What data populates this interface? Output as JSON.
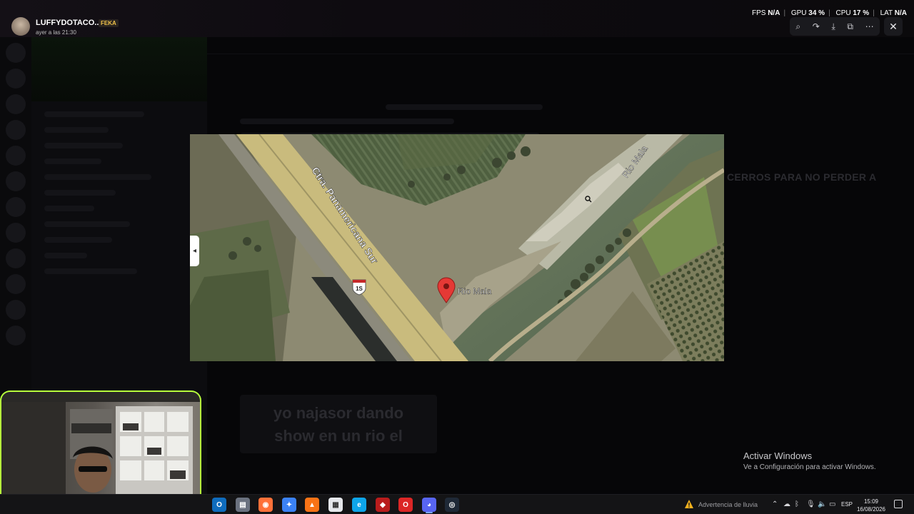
{
  "overlay": {
    "user_name": "LUFFYDOTACO...",
    "user_badge": "FEKA",
    "user_time": "ayer a las 21:30",
    "stats": [
      {
        "label": "FPS",
        "value": "N/A"
      },
      {
        "label": "GPU",
        "value": "34 %"
      },
      {
        "label": "CPU",
        "value": "17 %"
      },
      {
        "label": "LAT",
        "value": "N/A"
      }
    ]
  },
  "viewer": {
    "tools": [
      "zoom-in-icon",
      "forward-icon",
      "download-icon",
      "open-external-icon",
      "more-icon"
    ],
    "map": {
      "road_label": "Ctra. Panamericana Sur",
      "river_label": "Rio Mala",
      "pin_label": "Rio Mala",
      "shield_label": "1S"
    }
  },
  "background": {
    "heading_fragment": "CERROS PARA NO PERDER A",
    "sticker_text_line1": "yo najasor dando",
    "sticker_text_line2": "show en un rio el"
  },
  "watermark": {
    "title": "Activar Windows",
    "subtitle": "Ve a Configuración para activar Windows."
  },
  "taskbar": {
    "weather_text": "Advertencia de lluvia",
    "language": "ESP",
    "time": "15:09",
    "date": "16/08/2026",
    "apps": [
      {
        "name": "outlook",
        "color": "#0f6cbd",
        "glyph": "O"
      },
      {
        "name": "files",
        "color": "#6b7280",
        "glyph": "▤"
      },
      {
        "name": "firefox",
        "color": "#ff7139",
        "glyph": "◉"
      },
      {
        "name": "copilot",
        "color": "#3b82f6",
        "glyph": "✦"
      },
      {
        "name": "vlc",
        "color": "#f97316",
        "glyph": "▲"
      },
      {
        "name": "store",
        "color": "#e5e7eb",
        "glyph": "▦"
      },
      {
        "name": "edge",
        "color": "#0ea5e9",
        "glyph": "e"
      },
      {
        "name": "dota",
        "color": "#b91c1c",
        "glyph": "◆"
      },
      {
        "name": "opera",
        "color": "#dc2626",
        "glyph": "O"
      },
      {
        "name": "discord",
        "color": "#5865f2",
        "glyph": "◕"
      },
      {
        "name": "obs",
        "color": "#1f2937",
        "glyph": "◎"
      }
    ]
  },
  "colors": {
    "webcam_border": "#b7ff3c",
    "pin": "#e53935",
    "road": "#cdbf7e"
  }
}
